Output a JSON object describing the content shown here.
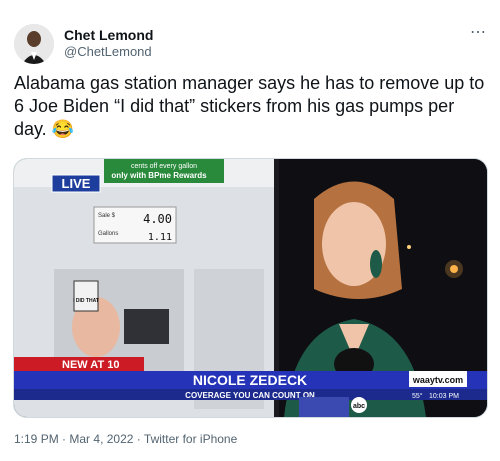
{
  "author": {
    "name": "Chet Lemond",
    "handle": "@ChetLemond"
  },
  "tweet": {
    "text": "Alabama gas station manager says he has to remove up to 6 Joe Biden “I did that” stickers from his gas pumps per day. 😂",
    "time": "1:19 PM",
    "date": "Mar 4, 2022",
    "client": "Twitter for iPhone"
  },
  "video": {
    "live_label": "LIVE",
    "pump_promo_line1": "cents off every gallon",
    "pump_promo_line2": "only with BPme Rewards",
    "pump_sale_label": "Sale $",
    "pump_sale_value": "4.00",
    "pump_gallons_label": "Gallons",
    "pump_gallons_value": "1.11",
    "sticker_text": "I DID THAT",
    "lower_third_tag": "NEW AT 10",
    "reporter_name": "NICOLE ZEDECK",
    "slogan": "COVERAGE YOU CAN COUNT ON",
    "station_site": "waaytv.com",
    "temperature": "55°",
    "clock": "10:03 PM",
    "station_logo": "abc"
  },
  "colors": {
    "live_blue": "#1d3e9c",
    "news_red": "#cc1b24",
    "name_blue": "#2433b8",
    "jacket_green": "#1e5a48"
  }
}
